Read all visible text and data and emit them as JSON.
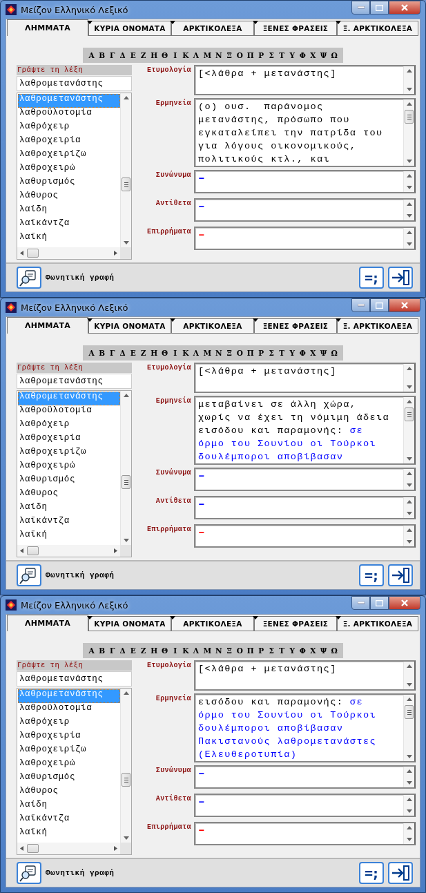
{
  "windows": [
    {
      "title": "Μείζον Ελληνικό Λεξικό",
      "tabs": [
        {
          "label": "ΛΗΜΜΑΤΑ",
          "selected": true
        },
        {
          "label": "ΚΥΡΙΑ ΟΝΟΜΑΤΑ",
          "selected": false
        },
        {
          "label": "ΑΡΚΤΙΚΟΛΕΞΑ",
          "selected": false
        },
        {
          "label": "ΞΕΝΕΣ ΦΡΑΣΕΙΣ",
          "selected": false
        },
        {
          "label": "Ξ. ΑΡΚΤΙΚΟΛΕΞΑ",
          "selected": false
        }
      ],
      "alphabet": [
        "Α",
        "Β",
        "Γ",
        "Δ",
        "Ε",
        "Ζ",
        "Η",
        "Θ",
        "Ι",
        "Κ",
        "Λ",
        "Μ",
        "Ν",
        "Ξ",
        "Ο",
        "Π",
        "Ρ",
        "Σ",
        "Τ",
        "Υ",
        "Φ",
        "Χ",
        "Ψ",
        "Ω"
      ],
      "search": {
        "label": "Γράψτε τη λέξη",
        "value": "λαθρομετανάστης"
      },
      "words": [
        {
          "text": "λαθρομετανάστης",
          "selected": true
        },
        {
          "text": "λαθροϋλοτομία",
          "selected": false
        },
        {
          "text": "λαθρόχειρ",
          "selected": false
        },
        {
          "text": "λαθροχειρία",
          "selected": false
        },
        {
          "text": "λαθροχειρίζω",
          "selected": false
        },
        {
          "text": "λαθροχειρώ",
          "selected": false
        },
        {
          "text": "λαθυρισμός",
          "selected": false
        },
        {
          "text": "λάθυρος",
          "selected": false
        },
        {
          "text": "λαίδη",
          "selected": false
        },
        {
          "text": "λαϊκάντζα",
          "selected": false
        },
        {
          "text": "λαϊκή",
          "selected": false
        }
      ],
      "fields": [
        {
          "label": "Ετυμολογία",
          "kind": "short",
          "lines": [
            [
              {
                "text": "[<λάθρα + μετανάστης]",
                "color": "#000000"
              }
            ]
          ]
        },
        {
          "label": "Ερμηνεία",
          "kind": "tall",
          "lines": [
            [
              {
                "text": "(ο) ουσ.  παράνομος",
                "color": "#000000"
              }
            ],
            [
              {
                "text": "μετανάστης, πρόσωπο που",
                "color": "#000000"
              }
            ],
            [
              {
                "text": "εγκαταλείπει την πατρίδα του",
                "color": "#000000"
              }
            ],
            [
              {
                "text": "για λόγους οικονομικούς,",
                "color": "#000000"
              }
            ],
            [
              {
                "text": "πολιτικούς κτλ., και",
                "color": "#000000"
              }
            ]
          ]
        },
        {
          "label": "Συνώνυμα",
          "kind": "single",
          "lines": [
            [
              {
                "text": "–",
                "color": "#0000ff"
              }
            ]
          ]
        },
        {
          "label": "Αντίθετα",
          "kind": "single",
          "lines": [
            [
              {
                "text": "–",
                "color": "#0000ff"
              }
            ]
          ]
        },
        {
          "label": "Επιρρήματα",
          "kind": "single",
          "lines": [
            [
              {
                "text": "–",
                "color": "#ff0000"
              }
            ]
          ]
        }
      ],
      "phonetic_button": "Φωνητική γραφή",
      "format_button": "=;"
    },
    {
      "title": "Μείζον Ελληνικό Λεξικό",
      "tabs": [
        {
          "label": "ΛΗΜΜΑΤΑ",
          "selected": true
        },
        {
          "label": "ΚΥΡΙΑ ΟΝΟΜΑΤΑ",
          "selected": false
        },
        {
          "label": "ΑΡΚΤΙΚΟΛΕΞΑ",
          "selected": false
        },
        {
          "label": "ΞΕΝΕΣ ΦΡΑΣΕΙΣ",
          "selected": false
        },
        {
          "label": "Ξ. ΑΡΚΤΙΚΟΛΕΞΑ",
          "selected": false
        }
      ],
      "alphabet": [
        "Α",
        "Β",
        "Γ",
        "Δ",
        "Ε",
        "Ζ",
        "Η",
        "Θ",
        "Ι",
        "Κ",
        "Λ",
        "Μ",
        "Ν",
        "Ξ",
        "Ο",
        "Π",
        "Ρ",
        "Σ",
        "Τ",
        "Υ",
        "Φ",
        "Χ",
        "Ψ",
        "Ω"
      ],
      "search": {
        "label": "Γράψτε τη λέξη",
        "value": "λαθρομετανάστης"
      },
      "words": [
        {
          "text": "λαθρομετανάστης",
          "selected": true
        },
        {
          "text": "λαθροϋλοτομία",
          "selected": false
        },
        {
          "text": "λαθρόχειρ",
          "selected": false
        },
        {
          "text": "λαθροχειρία",
          "selected": false
        },
        {
          "text": "λαθροχειρίζω",
          "selected": false
        },
        {
          "text": "λαθροχειρώ",
          "selected": false
        },
        {
          "text": "λαθυρισμός",
          "selected": false
        },
        {
          "text": "λάθυρος",
          "selected": false
        },
        {
          "text": "λαίδη",
          "selected": false
        },
        {
          "text": "λαϊκάντζα",
          "selected": false
        },
        {
          "text": "λαϊκή",
          "selected": false
        }
      ],
      "fields": [
        {
          "label": "Ετυμολογία",
          "kind": "short",
          "lines": [
            [
              {
                "text": "[<λάθρα + μετανάστης]",
                "color": "#000000"
              }
            ]
          ]
        },
        {
          "label": "Ερμηνεία",
          "kind": "tall",
          "lines": [
            [
              {
                "text": "μεταβαίνει σε άλλη χώρα,",
                "color": "#000000"
              }
            ],
            [
              {
                "text": "χωρίς να έχει τη νόμιμη άδεια",
                "color": "#000000"
              }
            ],
            [
              {
                "text": "εισόδου και παραμονής: ",
                "color": "#000000"
              },
              {
                "text": "σε",
                "color": "#0000ff"
              }
            ],
            [
              {
                "text": "όρμο του Σουνίου οι Τούρκοι",
                "color": "#0000ff"
              }
            ],
            [
              {
                "text": "δουλέμποροι αποβίβασαν",
                "color": "#0000ff"
              }
            ]
          ]
        },
        {
          "label": "Συνώνυμα",
          "kind": "single",
          "lines": [
            [
              {
                "text": "–",
                "color": "#0000ff"
              }
            ]
          ]
        },
        {
          "label": "Αντίθετα",
          "kind": "single",
          "lines": [
            [
              {
                "text": "–",
                "color": "#0000ff"
              }
            ]
          ]
        },
        {
          "label": "Επιρρήματα",
          "kind": "single",
          "lines": [
            [
              {
                "text": "–",
                "color": "#ff0000"
              }
            ]
          ]
        }
      ],
      "phonetic_button": "Φωνητική γραφή",
      "format_button": "=;"
    },
    {
      "title": "Μείζον Ελληνικό Λεξικό",
      "tabs": [
        {
          "label": "ΛΗΜΜΑΤΑ",
          "selected": true
        },
        {
          "label": "ΚΥΡΙΑ ΟΝΟΜΑΤΑ",
          "selected": false
        },
        {
          "label": "ΑΡΚΤΙΚΟΛΕΞΑ",
          "selected": false
        },
        {
          "label": "ΞΕΝΕΣ ΦΡΑΣΕΙΣ",
          "selected": false
        },
        {
          "label": "Ξ. ΑΡΚΤΙΚΟΛΕΞΑ",
          "selected": false
        }
      ],
      "alphabet": [
        "Α",
        "Β",
        "Γ",
        "Δ",
        "Ε",
        "Ζ",
        "Η",
        "Θ",
        "Ι",
        "Κ",
        "Λ",
        "Μ",
        "Ν",
        "Ξ",
        "Ο",
        "Π",
        "Ρ",
        "Σ",
        "Τ",
        "Υ",
        "Φ",
        "Χ",
        "Ψ",
        "Ω"
      ],
      "search": {
        "label": "Γράψτε τη λέξη",
        "value": "λαθρομετανάστης"
      },
      "words": [
        {
          "text": "λαθρομετανάστης",
          "selected": true
        },
        {
          "text": "λαθροϋλοτομία",
          "selected": false
        },
        {
          "text": "λαθρόχειρ",
          "selected": false
        },
        {
          "text": "λαθροχειρία",
          "selected": false
        },
        {
          "text": "λαθροχειρίζω",
          "selected": false
        },
        {
          "text": "λαθροχειρώ",
          "selected": false
        },
        {
          "text": "λαθυρισμός",
          "selected": false
        },
        {
          "text": "λάθυρος",
          "selected": false
        },
        {
          "text": "λαίδη",
          "selected": false
        },
        {
          "text": "λαϊκάντζα",
          "selected": false
        },
        {
          "text": "λαϊκή",
          "selected": false
        }
      ],
      "fields": [
        {
          "label": "Ετυμολογία",
          "kind": "short",
          "lines": [
            [
              {
                "text": "[<λάθρα + μετανάστης]",
                "color": "#000000"
              }
            ]
          ]
        },
        {
          "label": "Ερμηνεία",
          "kind": "tall",
          "lines": [
            [
              {
                "text": "εισόδου και παραμονής: ",
                "color": "#000000"
              },
              {
                "text": "σε",
                "color": "#0000ff"
              }
            ],
            [
              {
                "text": "όρμο του Σουνίου οι Τούρκοι",
                "color": "#0000ff"
              }
            ],
            [
              {
                "text": "δουλέμποροι αποβίβασαν",
                "color": "#0000ff"
              }
            ],
            [
              {
                "text": "Πακιστανούς λαθρομετανάστες",
                "color": "#0000ff"
              }
            ],
            [
              {
                "text": "(Ελευθεροτυπία)",
                "color": "#0000ff"
              }
            ]
          ]
        },
        {
          "label": "Συνώνυμα",
          "kind": "single",
          "lines": [
            [
              {
                "text": "–",
                "color": "#0000ff"
              }
            ]
          ]
        },
        {
          "label": "Αντίθετα",
          "kind": "single",
          "lines": [
            [
              {
                "text": "–",
                "color": "#0000ff"
              }
            ]
          ]
        },
        {
          "label": "Επιρρήματα",
          "kind": "single",
          "lines": [
            [
              {
                "text": "–",
                "color": "#ff0000"
              }
            ]
          ]
        }
      ],
      "phonetic_button": "Φωνητική γραφή",
      "format_button": "=;"
    }
  ]
}
